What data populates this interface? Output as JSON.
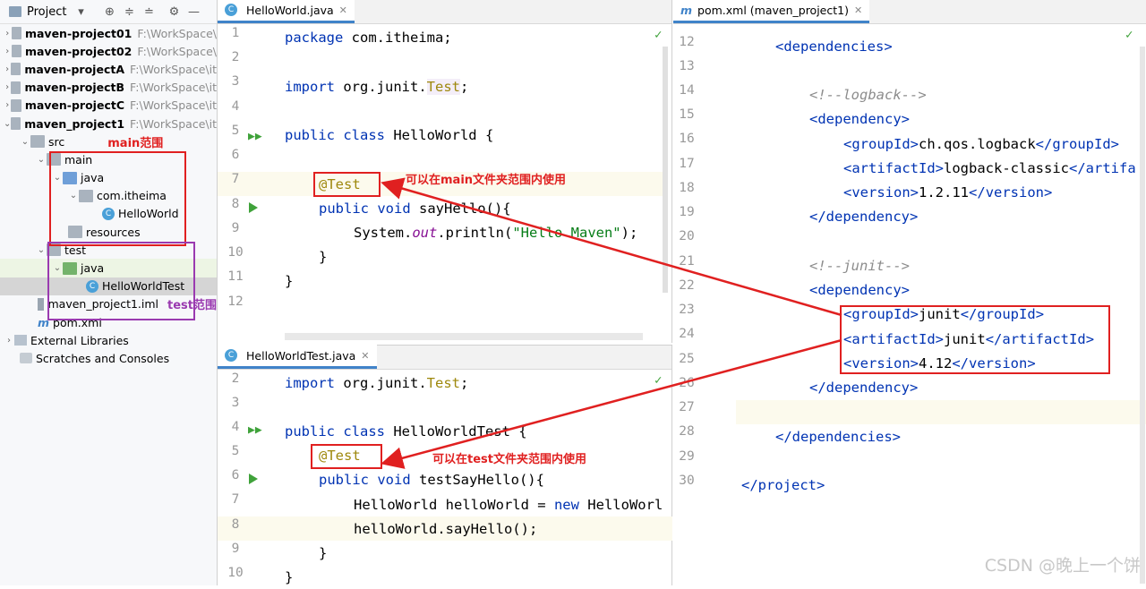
{
  "project_panel": {
    "title": "Project",
    "tree": [
      {
        "name": "maven-project01",
        "path": "F:\\WorkSpace\\"
      },
      {
        "name": "maven-project02",
        "path": "F:\\WorkSpace\\"
      },
      {
        "name": "maven-projectA",
        "path": "F:\\WorkSpace\\it"
      },
      {
        "name": "maven-projectB",
        "path": "F:\\WorkSpace\\it"
      },
      {
        "name": "maven-projectC",
        "path": "F:\\WorkSpace\\it"
      },
      {
        "name": "maven_project1",
        "path": "F:\\WorkSpace\\it"
      }
    ],
    "src": "src",
    "main": "main",
    "java": "java",
    "package": "com.itheima",
    "main_class": "HelloWorld",
    "resources": "resources",
    "test": "test",
    "test_java": "java",
    "test_class": "HelloWorldTest",
    "iml": "maven_project1.iml",
    "pom": "pom.xml",
    "external": "External Libraries",
    "scratches": "Scratches and Consoles",
    "anno_main": "main范围",
    "anno_test": "test范围"
  },
  "editor1": {
    "tab": "HelloWorld.java",
    "line_numbers": [
      "1",
      "2",
      "3",
      "4",
      "5",
      "6",
      "7",
      "8",
      "9",
      "10",
      "11",
      "12"
    ],
    "lines": {
      "l1_kw": "package",
      "l1_rest": " com.itheima;",
      "l3_kw": "import",
      "l3_rest": " org.junit.",
      "l3_cls": "Test",
      "l3_end": ";",
      "l5_kw": "public class",
      "l5_rest": " HelloWorld {",
      "l7_ann": "@Test",
      "l8_kw": "public void",
      "l8_rest": " sayHello(){",
      "l9_a": "System.",
      "l9_out": "out",
      "l9_b": ".println(",
      "l9_str": "\"Hello Maven\"",
      "l9_c": ");",
      "l10": "}",
      "l11": "}"
    },
    "annotation": "可以在main文件夹范围内使用"
  },
  "editor2": {
    "tab": "HelloWorldTest.java",
    "line_numbers": [
      "2",
      "3",
      "4",
      "5",
      "6",
      "7",
      "8",
      "9",
      "10"
    ],
    "lines": {
      "l2_kw": "import",
      "l2_rest": " org.junit.",
      "l2_cls": "Test",
      "l2_end": ";",
      "l4_kw": "public class",
      "l4_rest": " HelloWorldTest {",
      "l5_ann": "@Test",
      "l6_kw": "public void",
      "l6_rest": " testSayHello(){",
      "l7_a": "HelloWorld helloWorld = ",
      "l7_kw": "new",
      "l7_b": " HelloWorl",
      "l8": "helloWorld.sayHello();",
      "l9": "}",
      "l10": "}"
    },
    "annotation": "可以在test文件夹范围内使用"
  },
  "editor3": {
    "tab": "pom.xml (maven_project1)",
    "line_numbers": [
      "12",
      "13",
      "14",
      "15",
      "16",
      "17",
      "18",
      "19",
      "20",
      "21",
      "22",
      "23",
      "24",
      "25",
      "26",
      "27",
      "28",
      "29",
      "30"
    ],
    "lines": {
      "l12": "dependencies",
      "l14": "<!--logback-->",
      "l15": "dependency",
      "l16_tag": "groupId",
      "l16_val": "ch.qos.logback",
      "l17_tag": "artifactId",
      "l17_val": "logback-classic",
      "l17_tail": "artifa",
      "l18_tag": "version",
      "l18_val": "1.2.11",
      "l19": "dependency",
      "l21": "<!--junit-->",
      "l22": "dependency",
      "l23_tag": "groupId",
      "l23_val": "junit",
      "l24_tag": "artifactId",
      "l24_val": "junit",
      "l25_tag": "version",
      "l25_val": "4.12",
      "l26": "dependency",
      "l28": "dependencies",
      "l30": "project"
    }
  },
  "watermark": "CSDN @晚上一个饼"
}
